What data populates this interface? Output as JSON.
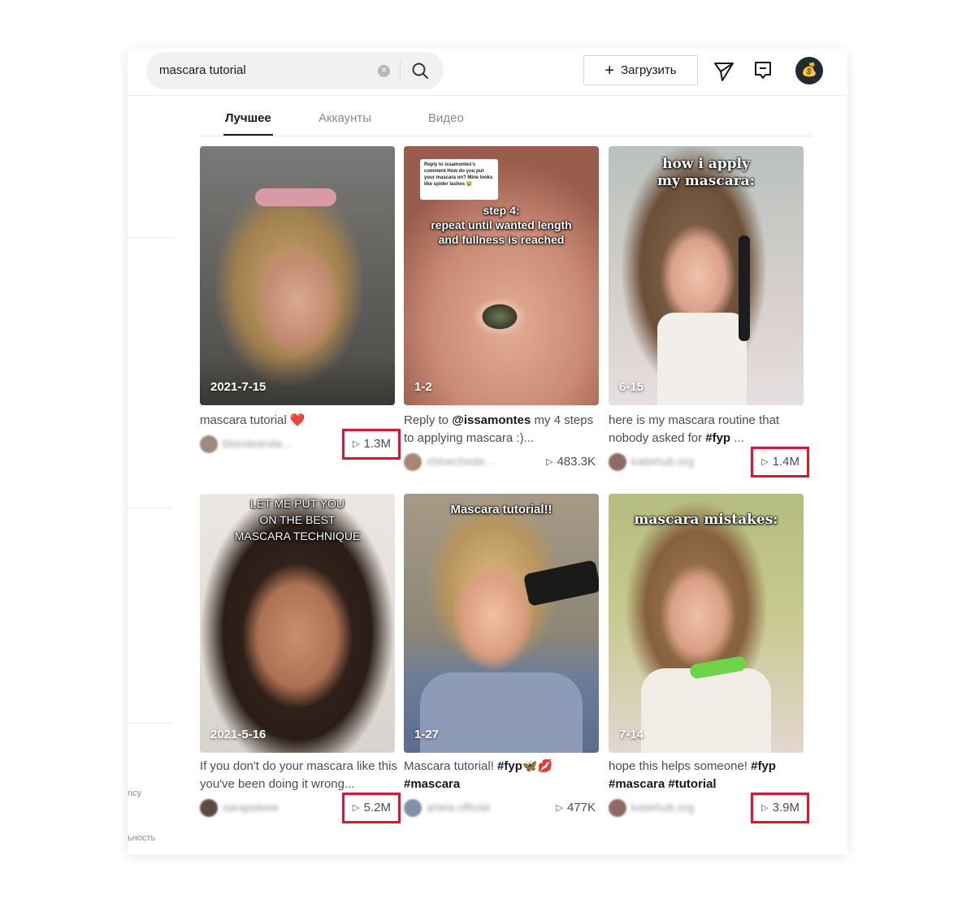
{
  "search": {
    "value": "mascara tutorial",
    "clear_icon": "clear-circle-icon",
    "search_icon": "magnifier-icon"
  },
  "header": {
    "upload_label": "Загрузить",
    "icons": [
      "plus-icon",
      "send-icon",
      "inbox-icon",
      "avatar"
    ],
    "avatar_glyph": "💰"
  },
  "sidebar": {
    "cut_text_1": "ncy",
    "cut_text_2": "ьность"
  },
  "tabs": [
    {
      "label": "Лучшее",
      "active": true
    },
    {
      "label": "Аккаунты",
      "active": false
    },
    {
      "label": "Видео",
      "active": false
    }
  ],
  "highlight_color": "#e8112d",
  "videos": [
    {
      "date": "2021-7-15",
      "overlay_text": "",
      "description": "mascara tutorial ❤️",
      "author": "blondeanda...",
      "views": "1.3M",
      "highlighted": true
    },
    {
      "date": "1-2",
      "overlay_text": "step 4:\nrepeat until wanted length\nand fullness is reached",
      "comment_bubble": "Reply to issamontes's comment\nHow do you put your mascara on? Mine looks like spider lashes 😭",
      "description_prefix": "Reply to ",
      "description_mention": "@issamontes",
      "description_suffix": " my 4 steps to applying mascara :)...",
      "author": "chloechede...",
      "views": "483.3K",
      "highlighted": false
    },
    {
      "date": "6-15",
      "overlay_text": "how i apply\nmy mascara:",
      "description_prefix": "here is my mascara routine that nobody asked for ",
      "description_tag": "#fyp",
      "description_suffix": " ...",
      "author": "katiehub.org",
      "views": "1.4M",
      "highlighted": true
    },
    {
      "date": "2021-5-16",
      "overlay_text": "LET ME PUT YOU\nON THE BEST\nMASCARA TECHNIQUE",
      "description": "If you don't do your mascara like this you've been doing it wrong...",
      "author": "sarajadeee",
      "views": "5.2M",
      "highlighted": true
    },
    {
      "date": "1-27",
      "overlay_text": "Mascara tutorial!!",
      "description_prefix": "Mascara tutorial! ",
      "description_tag": "#fyp",
      "description_suffix": "🦋💋",
      "description_tag2": "#mascara",
      "author": "ariela.official",
      "views": "477K",
      "highlighted": false
    },
    {
      "date": "7-14",
      "overlay_text": "mascara mistakes:",
      "description_prefix": "hope this helps someone! ",
      "description_tag": "#fyp",
      "description_tag2": "#mascara",
      "description_tag3": "#tutorial",
      "author": "katiehub.org",
      "views": "3.9M",
      "highlighted": true
    }
  ]
}
